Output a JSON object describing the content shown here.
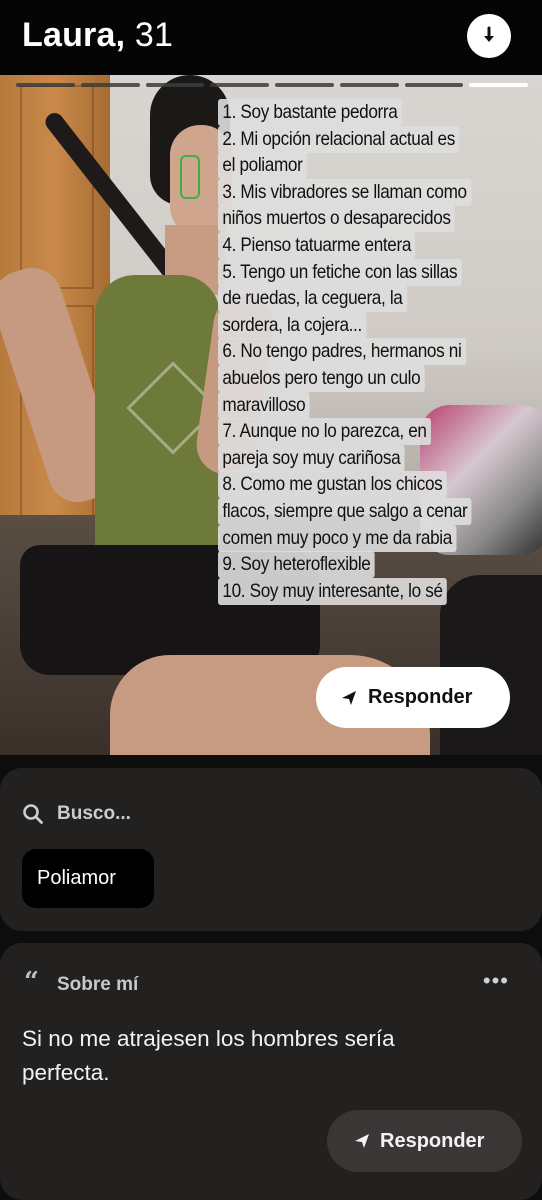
{
  "header": {
    "name": "Laura,",
    "age": "31",
    "story_count": 8,
    "active_story_index": 8
  },
  "photo": {
    "list_lines": [
      "1. Soy bastante pedorra",
      "2. Mi opción relacional actual es",
      "el poliamor",
      "3. Mis vibradores se llaman como",
      "niños  muertos o desaparecidos",
      "4. Pienso tatuarme entera",
      "5. Tengo un fetiche con las sillas",
      "de ruedas, la ceguera, la",
      "sordera, la cojera...",
      "6. No tengo padres, hermanos ni",
      "abuelos pero tengo un culo",
      "maravilloso",
      "7. Aunque no lo parezca, en",
      "pareja soy muy cariñosa",
      "8. Como me gustan los chicos",
      "flacos, siempre que salgo a cenar",
      "comen muy poco y me da rabia",
      "9. Soy heteroflexible",
      "10. Soy muy interesante, lo sé"
    ],
    "respond_label": "Responder"
  },
  "looking_for": {
    "title": "Busco...",
    "chip": "Poliamor"
  },
  "about": {
    "title": "Sobre mí",
    "quote_glyph": "“",
    "more_glyph": "•••",
    "bio": "Si no me atrajesen los hombres sería perfecta.",
    "respond_label": "Responder"
  }
}
